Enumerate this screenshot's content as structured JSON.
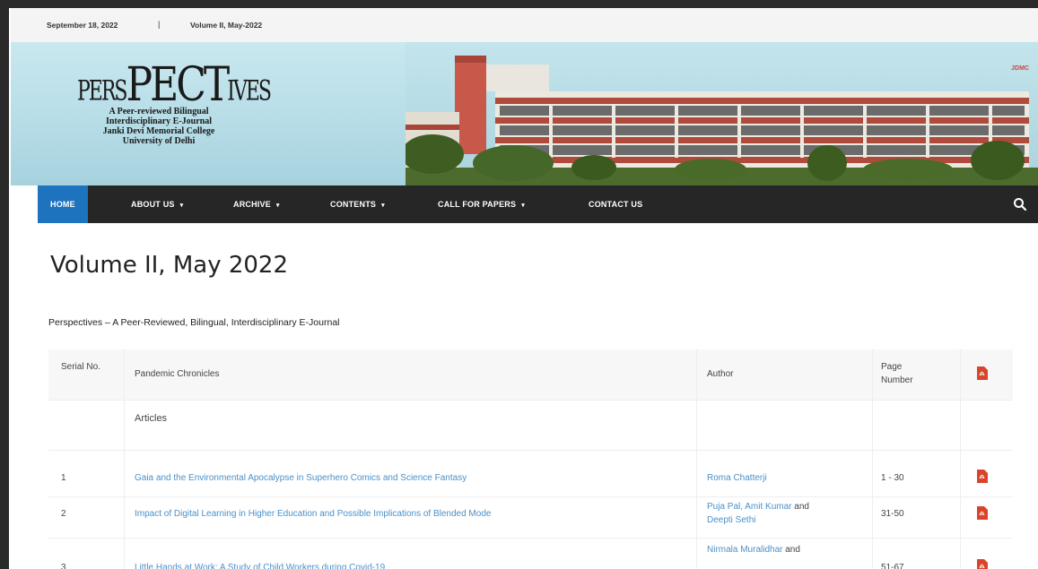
{
  "topbar": {
    "date": "September 18, 2022",
    "separator": "|",
    "volume": "Volume II, May-2022"
  },
  "logo": {
    "word_small": "PERS",
    "word_big": "PECT",
    "word_tail": "IVES",
    "line1": "A Peer-reviewed Bilingual",
    "line2": "Interdisciplinary E-Journal",
    "line3": "Janki Devi Memorial College",
    "line4": "University of Delhi"
  },
  "header_tag": "JDMC",
  "nav": {
    "items": [
      {
        "label": "HOME"
      },
      {
        "label": "ABOUT US"
      },
      {
        "label": "ARCHIVE"
      },
      {
        "label": "CONTENTS"
      },
      {
        "label": "CALL FOR PAPERS"
      },
      {
        "label": "CONTACT US"
      }
    ],
    "caret": "▾",
    "search_icon": "search-icon"
  },
  "page": {
    "title": "Volume II, May 2022",
    "subtitle": "Perspectives – A Peer-Reviewed, Bilingual, Interdisciplinary E-Journal"
  },
  "table": {
    "headers": {
      "serial": "Serial No.",
      "title": "Pandemic Chronicles",
      "author": "Author",
      "page": "Page Number",
      "pdf_icon": "pdf-icon"
    },
    "section": "Articles",
    "rows": [
      {
        "serial": "1",
        "title": "Gaia and the Environmental Apocalypse in Superhero Comics and Science Fantasy",
        "author": "Roma Chatterji",
        "author_extra": "",
        "pages": "1 - 30"
      },
      {
        "serial": "2",
        "title": "Impact of Digital Learning in Higher Education and Possible Implications of Blended Mode",
        "author": "Puja Pal, Amit Kumar",
        "author_extra": "and",
        "author_line2": "Deepti Sethi",
        "pages": "31-50"
      },
      {
        "serial": "3",
        "title": "Little Hands at Work: A Study of Child Workers during Covid-19",
        "author": "Nirmala Muralidhar",
        "author_extra": "and",
        "pages": "51-67"
      }
    ]
  },
  "colors": {
    "nav_bg": "#262626",
    "nav_active": "#1e73be",
    "link": "#4a90c8",
    "pdf_red": "#d9452b"
  }
}
